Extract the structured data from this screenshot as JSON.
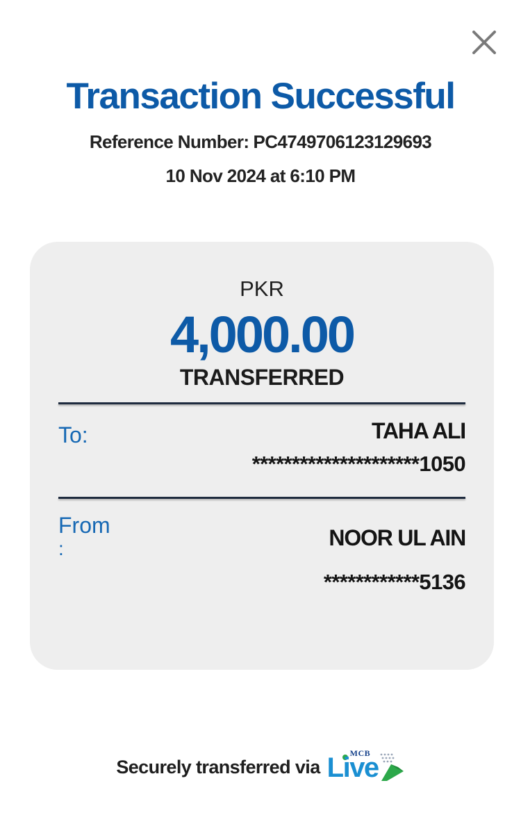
{
  "header": {
    "title": "Transaction Successful",
    "reference_label": "Reference Number:",
    "reference_number": "PC4749706123129693",
    "datetime": "10 Nov 2024 at 6:10 PM"
  },
  "amount": {
    "currency": "PKR",
    "value": "4,000.00",
    "status": "TRANSFERRED"
  },
  "recipient": {
    "label": "To:",
    "name": "TAHA ALI",
    "account": "*********************1050"
  },
  "sender": {
    "label": "From",
    "colon": ":",
    "name": "NOOR UL AIN",
    "account": "************5136"
  },
  "footer": {
    "text": "Securely transferred via",
    "brand_small": "MCB",
    "brand_main": "Live"
  },
  "colors": {
    "accent": "#0d5aa7",
    "label_blue": "#1668b4",
    "card_bg": "#eeeeee",
    "brand_green": "#2ca84a"
  },
  "icons": {
    "close": "close-icon",
    "brand_arrow": "arrow-right-icon"
  }
}
